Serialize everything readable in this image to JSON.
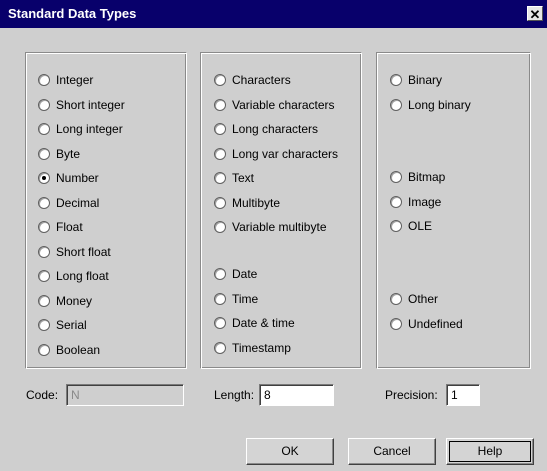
{
  "window": {
    "title": "Standard Data Types",
    "close_glyph": "✕",
    "close_icon": "close-icon"
  },
  "groups": {
    "numeric": [
      {
        "label": "Integer",
        "checked": false
      },
      {
        "label": "Short integer",
        "checked": false
      },
      {
        "label": "Long integer",
        "checked": false
      },
      {
        "label": "Byte",
        "checked": false
      },
      {
        "label": "Number",
        "checked": true
      },
      {
        "label": "Decimal",
        "checked": false
      },
      {
        "label": "Float",
        "checked": false
      },
      {
        "label": "Short float",
        "checked": false
      },
      {
        "label": "Long float",
        "checked": false
      },
      {
        "label": "Money",
        "checked": false
      },
      {
        "label": "Serial",
        "checked": false
      },
      {
        "label": "Boolean",
        "checked": false
      }
    ],
    "character": [
      {
        "label": "Characters",
        "checked": false
      },
      {
        "label": "Variable characters",
        "checked": false
      },
      {
        "label": "Long characters",
        "checked": false
      },
      {
        "label": "Long var characters",
        "checked": false
      },
      {
        "label": "Text",
        "checked": false
      },
      {
        "label": "Multibyte",
        "checked": false
      },
      {
        "label": "Variable multibyte",
        "checked": false
      }
    ],
    "datetime": [
      {
        "label": "Date",
        "checked": false
      },
      {
        "label": "Time",
        "checked": false
      },
      {
        "label": "Date & time",
        "checked": false
      },
      {
        "label": "Timestamp",
        "checked": false
      }
    ],
    "binary": [
      {
        "label": "Binary",
        "checked": false
      },
      {
        "label": "Long binary",
        "checked": false
      }
    ],
    "image": [
      {
        "label": "Bitmap",
        "checked": false
      },
      {
        "label": "Image",
        "checked": false
      },
      {
        "label": "OLE",
        "checked": false
      }
    ],
    "other": [
      {
        "label": "Other",
        "checked": false
      },
      {
        "label": "Undefined",
        "checked": false
      }
    ]
  },
  "fields": {
    "code": {
      "label": "Code:",
      "value": "N"
    },
    "length": {
      "label": "Length:",
      "value": "8"
    },
    "precision": {
      "label": "Precision:",
      "value": "1"
    }
  },
  "buttons": {
    "ok": "OK",
    "cancel": "Cancel",
    "help": "Help"
  },
  "colors": {
    "titlebar": "#08006b",
    "face": "#cfcfcf"
  }
}
